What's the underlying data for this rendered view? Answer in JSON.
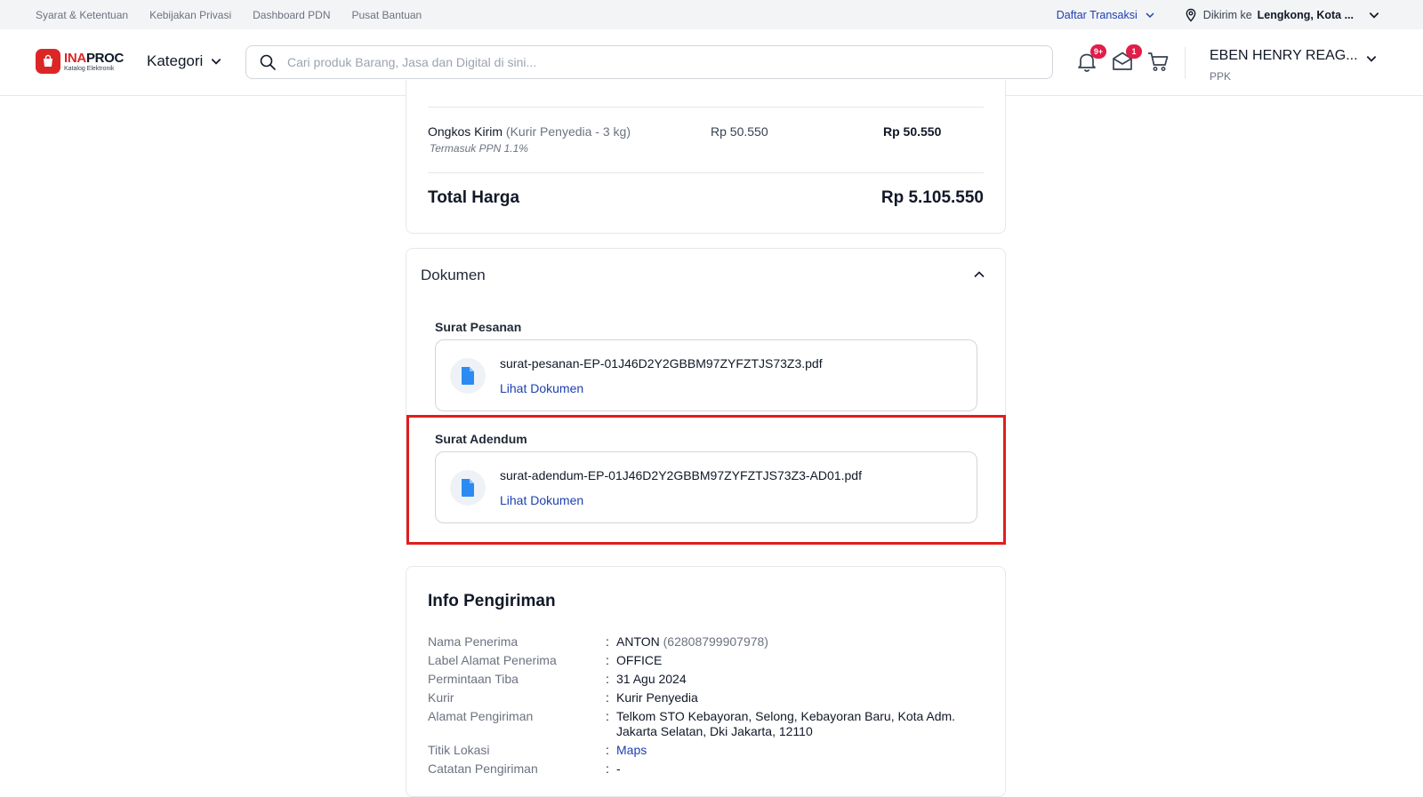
{
  "topbar": {
    "links": [
      "Syarat & Ketentuan",
      "Kebijakan Privasi",
      "Dashboard PDN",
      "Pusat Bantuan"
    ],
    "transactions_label": "Daftar Transaksi",
    "send_to_label": "Dikirim ke",
    "send_to_location": "Lengkong, Kota ..."
  },
  "header": {
    "logo_text_1": "INA",
    "logo_text_2": "PROC",
    "logo_subtitle": "Katalog Elektronik",
    "category_label": "Kategori",
    "search_placeholder": "Cari produk Barang, Jasa dan Digital di sini...",
    "notification_badge": "9+",
    "message_badge": "1",
    "user_name": "EBEN HENRY REAG...",
    "user_role": "PPK"
  },
  "summary": {
    "shipping_label": "Ongkos Kirim",
    "shipping_detail": "(Kurir Penyedia - 3 kg)",
    "shipping_note": "Termasuk PPN 1.1%",
    "shipping_price": "Rp 50.550",
    "shipping_total": "Rp 50.550",
    "total_label": "Total Harga",
    "total_value": "Rp 5.105.550"
  },
  "documents": {
    "title": "Dokumen",
    "sections": [
      {
        "label": "Surat Pesanan",
        "file_name": "surat-pesanan-EP-01J46D2Y2GBBM97ZYFZTJS73Z3.pdf",
        "link": "Lihat Dokumen"
      },
      {
        "label": "Surat Adendum",
        "file_name": "surat-adendum-EP-01J46D2Y2GBBM97ZYFZTJS73Z3-AD01.pdf",
        "link": "Lihat Dokumen"
      }
    ]
  },
  "shipping_info": {
    "title": "Info Pengiriman",
    "rows": [
      {
        "key": "Nama Penerima",
        "value": "ANTON",
        "extra": "(62808799907978)"
      },
      {
        "key": "Label Alamat Penerima",
        "value": "OFFICE"
      },
      {
        "key": "Permintaan Tiba",
        "value": "31 Agu 2024"
      },
      {
        "key": "Kurir",
        "value": "Kurir Penyedia"
      },
      {
        "key": "Alamat Pengiriman",
        "value": "Telkom STO Kebayoran, Selong, Kebayoran Baru, Kota Adm. Jakarta Selatan, Dki Jakarta, 12110"
      },
      {
        "key": "Titik Lokasi",
        "value": "Maps"
      },
      {
        "key": "Catatan Pengiriman",
        "value": "-"
      }
    ]
  },
  "colors": {
    "accent": "#1e40af",
    "brand": "#dc2626",
    "highlight": "#e11d1d",
    "badge": "#e11d48"
  }
}
